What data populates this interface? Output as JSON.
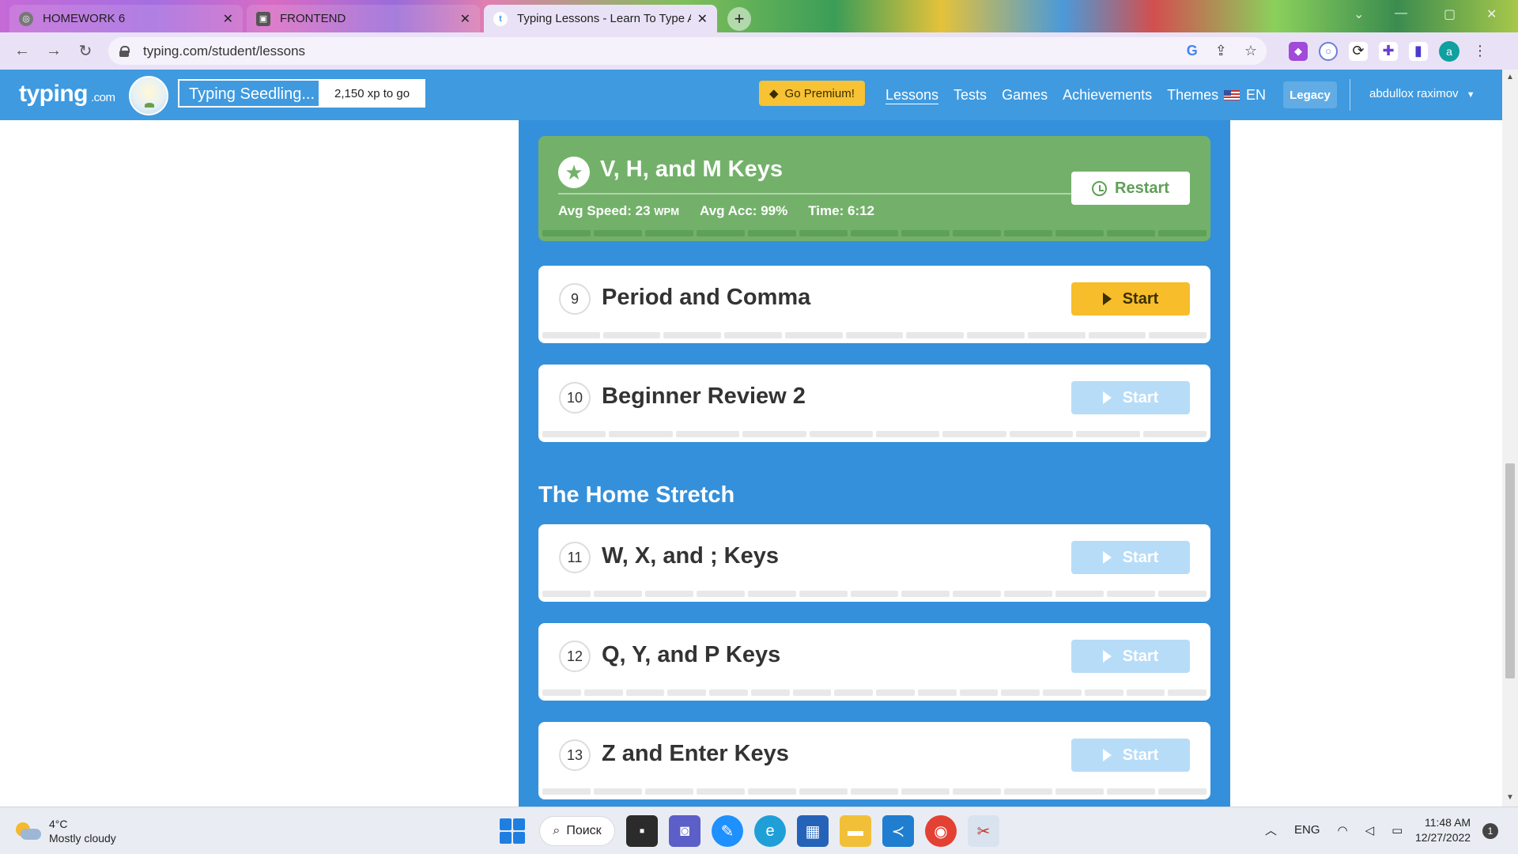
{
  "browser": {
    "tabs": [
      {
        "title": "HOMEWORK 6",
        "active": false
      },
      {
        "title": "FRONTEND",
        "active": false
      },
      {
        "title": "Typing Lessons - Learn To Type A",
        "active": true
      }
    ],
    "url": "typing.com/student/lessons",
    "profile_initial": "a"
  },
  "site": {
    "logo_text": "typing",
    "logo_suffix": ".com",
    "level_name": "Typing Seedling...",
    "level_progress": 0.57,
    "xp_to_go": "2,150 xp to go",
    "premium_label": "Go Premium!",
    "nav": [
      "Lessons",
      "Tests",
      "Games",
      "Achievements",
      "Themes"
    ],
    "active_nav": "Lessons",
    "language": "EN",
    "legacy_label": "Legacy",
    "username": "abdullox raximov"
  },
  "completed_lesson": {
    "title": "V, H, and M Keys",
    "avg_speed_label": "Avg Speed: 23",
    "speed_unit": "WPM",
    "avg_acc": "Avg Acc: 99%",
    "time": "Time: 6:12",
    "restart_label": "Restart",
    "segments": 13
  },
  "lessons_before": [
    {
      "number": "9",
      "title": "Period and Comma",
      "button": "Start",
      "enabled": true,
      "segments": 11
    },
    {
      "number": "10",
      "title": "Beginner Review 2",
      "button": "Start",
      "enabled": false,
      "segments": 10
    }
  ],
  "section_heading": "The Home Stretch",
  "lessons_after": [
    {
      "number": "11",
      "title": "W, X, and ; Keys",
      "button": "Start",
      "enabled": false,
      "segments": 13
    },
    {
      "number": "12",
      "title": "Q, Y, and P Keys",
      "button": "Start",
      "enabled": false,
      "segments": 16
    },
    {
      "number": "13",
      "title": "Z and Enter Keys",
      "button": "Start",
      "enabled": false,
      "segments": 13
    }
  ],
  "taskbar": {
    "temperature": "4°C",
    "weather": "Mostly cloudy",
    "search_label": "Поиск",
    "language": "ENG",
    "time": "11:48 AM",
    "date": "12/27/2022",
    "notifications": "1"
  }
}
